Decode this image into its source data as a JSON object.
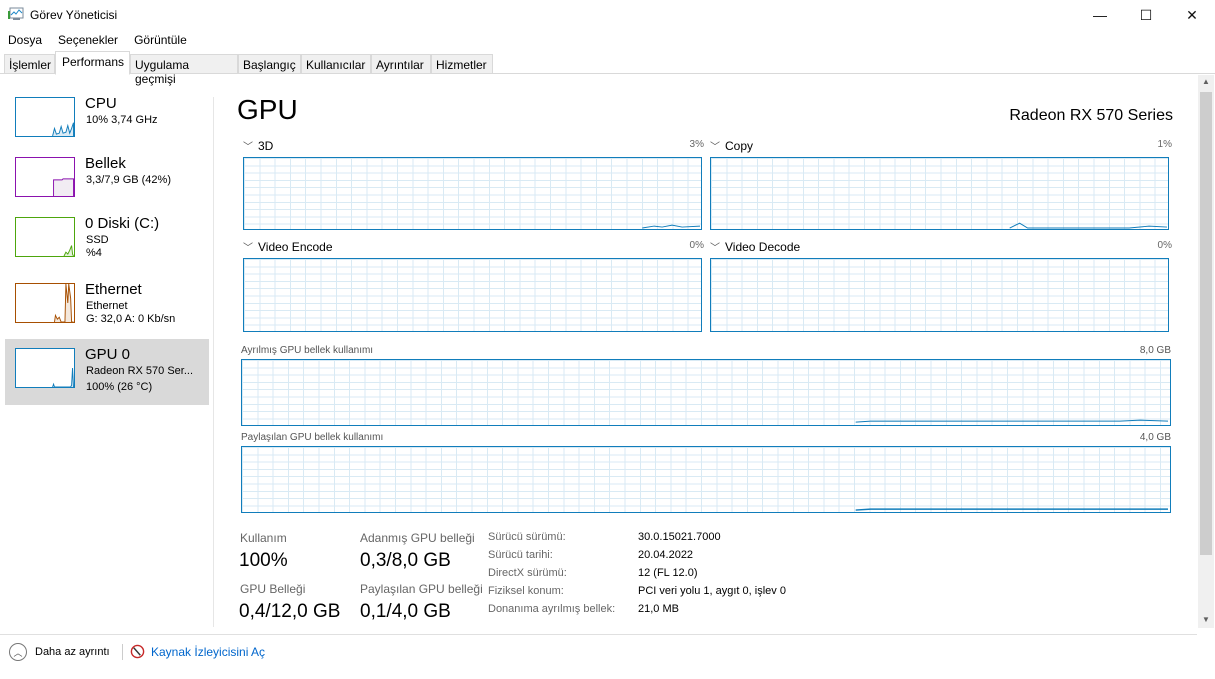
{
  "window": {
    "title": "Görev Yöneticisi",
    "minimize": "—",
    "maximize": "☐",
    "close": "✕"
  },
  "menu": [
    "Dosya",
    "Seçenekler",
    "Görüntüle"
  ],
  "tabs": [
    "İşlemler",
    "Performans",
    "Uygulama geçmişi",
    "Başlangıç",
    "Kullanıcılar",
    "Ayrıntılar",
    "Hizmetler"
  ],
  "sidebar": [
    {
      "name": "CPU",
      "l1": "10% 3,74 GHz",
      "l2": "",
      "color": "#117dbb"
    },
    {
      "name": "Bellek",
      "l1": "3,3/7,9 GB (42%)",
      "l2": "",
      "color": "#8b12ae"
    },
    {
      "name": "0 Diski (C:)",
      "l1": "SSD",
      "l2": "%4",
      "color": "#4da60c"
    },
    {
      "name": "Ethernet",
      "l1": "Ethernet",
      "l2": "G: 32,0 A: 0 Kb/sn",
      "color": "#a74f01"
    },
    {
      "name": "GPU 0",
      "l1": "Radeon RX 570 Ser...",
      "l2": "100%  (26 °C)",
      "color": "#117dbb"
    }
  ],
  "main": {
    "title": "GPU",
    "device": "Radeon RX 570 Series",
    "engines": [
      {
        "label": "3D",
        "pct": "3%"
      },
      {
        "label": "Copy",
        "pct": "1%"
      },
      {
        "label": "Video Encode",
        "pct": "0%"
      },
      {
        "label": "Video Decode",
        "pct": "0%"
      }
    ],
    "dedicated": {
      "label": "Ayrılmış GPU bellek kullanımı",
      "max": "8,0 GB"
    },
    "shared": {
      "label": "Paylaşılan GPU bellek kullanımı",
      "max": "4,0 GB"
    },
    "stats": [
      {
        "label": "Kullanım",
        "value": "100%"
      },
      {
        "label": "Adanmış GPU belleği",
        "value": "0,3/8,0 GB"
      },
      {
        "label": "GPU Belleği",
        "value": "0,4/12,0 GB"
      },
      {
        "label": "Paylaşılan GPU belleği",
        "value": "0,1/4,0 GB"
      }
    ],
    "details": [
      {
        "k": "Sürücü sürümü:",
        "v": "30.0.15021.7000"
      },
      {
        "k": "Sürücü tarihi:",
        "v": "20.04.2022"
      },
      {
        "k": "DirectX sürümü:",
        "v": "12 (FL 12.0)"
      },
      {
        "k": "Fiziksel konum:",
        "v": "PCI veri yolu 1, aygıt 0, işlev 0"
      },
      {
        "k": "Donanıma ayrılmış bellek:",
        "v": "21,0 MB"
      }
    ]
  },
  "footer": {
    "less": "Daha az ayrıntı",
    "monitor": "Kaynak İzleyicisini Aç"
  }
}
